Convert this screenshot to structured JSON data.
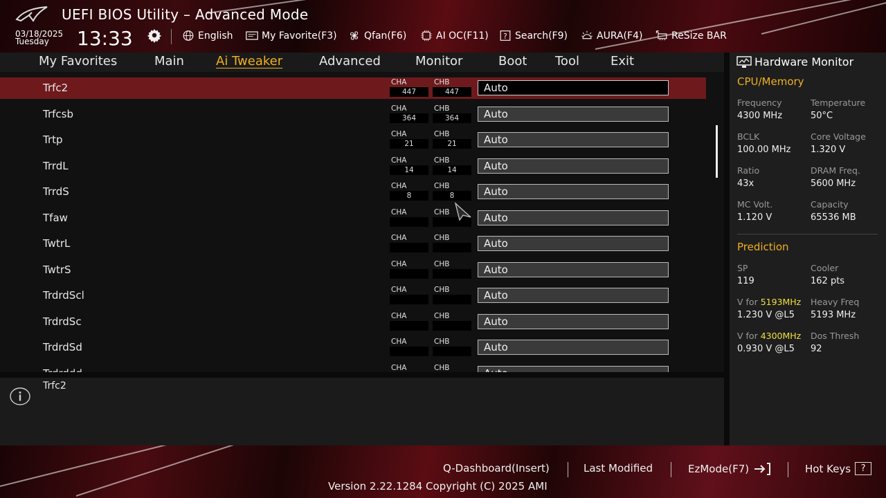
{
  "header": {
    "title": "UEFI BIOS Utility – Advanced Mode",
    "date": "03/18/2025",
    "day": "Tuesday",
    "time": "13:33",
    "toolbar": [
      {
        "label": "English",
        "icon": "globe-icon"
      },
      {
        "label": "My Favorite(F3)",
        "icon": "favorite-icon"
      },
      {
        "label": "Qfan(F6)",
        "icon": "fan-icon"
      },
      {
        "label": "AI OC(F11)",
        "icon": "ai-oc-icon"
      },
      {
        "label": "Search(F9)",
        "icon": "search-icon"
      },
      {
        "label": "AURA(F4)",
        "icon": "aura-icon"
      },
      {
        "label": "ReSize BAR",
        "icon": "resize-bar-icon"
      }
    ]
  },
  "menu": {
    "tabs": [
      "My Favorites",
      "Main",
      "Ai Tweaker",
      "Advanced",
      "Monitor",
      "Boot",
      "Tool",
      "Exit"
    ],
    "active": "Ai Tweaker"
  },
  "rows": [
    {
      "label": "Trfc2",
      "cha": "447",
      "chb": "447",
      "value": "Auto",
      "selected": true
    },
    {
      "label": "Trfcsb",
      "cha": "364",
      "chb": "364",
      "value": "Auto"
    },
    {
      "label": "Trtp",
      "cha": "21",
      "chb": "21",
      "value": "Auto"
    },
    {
      "label": "TrrdL",
      "cha": "14",
      "chb": "14",
      "value": "Auto"
    },
    {
      "label": "TrrdS",
      "cha": "8",
      "chb": "8",
      "value": "Auto"
    },
    {
      "label": "Tfaw",
      "cha": "",
      "chb": "",
      "value": "Auto"
    },
    {
      "label": "TwtrL",
      "cha": "",
      "chb": "",
      "value": "Auto"
    },
    {
      "label": "TwtrS",
      "cha": "",
      "chb": "",
      "value": "Auto"
    },
    {
      "label": "TrdrdScl",
      "cha": "",
      "chb": "",
      "value": "Auto"
    },
    {
      "label": "TrdrdSc",
      "cha": "",
      "chb": "",
      "value": "Auto"
    },
    {
      "label": "TrdrdSd",
      "cha": "",
      "chb": "",
      "value": "Auto"
    },
    {
      "label": "Trdrddd",
      "cha": "",
      "chb": "",
      "value": "Auto"
    }
  ],
  "channel_labels": {
    "a": "CHA",
    "b": "CHB"
  },
  "help": {
    "text": "Trfc2"
  },
  "hw_monitor": {
    "title": "Hardware Monitor",
    "cpu_section": "CPU/Memory",
    "stats": [
      {
        "k1": "Frequency",
        "v1": "4300 MHz",
        "k2": "Temperature",
        "v2": "50°C"
      },
      {
        "k1": "BCLK",
        "v1": "100.00 MHz",
        "k2": "Core Voltage",
        "v2": "1.320 V"
      },
      {
        "k1": "Ratio",
        "v1": "43x",
        "k2": "DRAM Freq.",
        "v2": "5600 MHz"
      },
      {
        "k1": "MC Volt.",
        "v1": "1.120 V",
        "k2": "Capacity",
        "v2": "65536 MB"
      }
    ],
    "prediction_section": "Prediction",
    "sp_label": "SP",
    "sp_value": "119",
    "cooler_label": "Cooler",
    "cooler_value": "162 pts",
    "vfor_prefix": "V for ",
    "vfor1_freq": "5193MHz",
    "vfor1_value": "1.230 V @L5",
    "heavy_label": "Heavy Freq",
    "heavy_value": "5193 MHz",
    "vfor2_freq": "4300MHz",
    "vfor2_value": "0.930 V @L5",
    "dos_label": "Dos Thresh",
    "dos_value": "92"
  },
  "footer": {
    "qdash": "Q-Dashboard(Insert)",
    "last_modified": "Last Modified",
    "ezmode": "EzMode(F7)",
    "hotkeys": "Hot Keys",
    "hotkeys_key": "?",
    "version": "Version 2.22.1284 Copyright (C) 2025 AMI"
  },
  "colors": {
    "accent": "#f0b020",
    "selected_row": "#6e1a1d",
    "highlight": "#f0e040"
  }
}
